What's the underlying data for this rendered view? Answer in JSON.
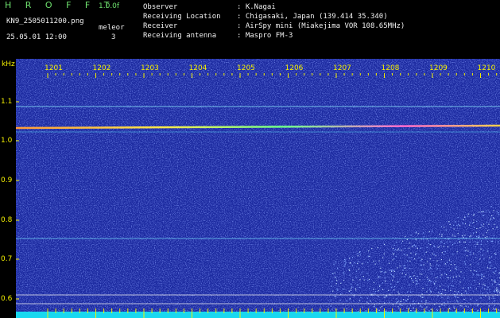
{
  "app": {
    "logo": "H R O F F T",
    "version": "1.0.0f",
    "filename": "KN9_2505011200.png",
    "mode": "meleor",
    "datetime": "25.05.01 12:00",
    "count": "3"
  },
  "info": [
    {
      "label": "Observer",
      "value": ": K.Nagai"
    },
    {
      "label": "Receiving Location",
      "value": ": Chigasaki, Japan (139.414 35.340)"
    },
    {
      "label": "Receiver",
      "value": ": AirSpy mini (Miakejima VOR 108.65MHz)"
    },
    {
      "label": "Receiving antenna",
      "value": ": Maspro FM-3"
    }
  ],
  "axis": {
    "unit": "kHz",
    "y_ticks": [
      "1.1",
      "1.0",
      "0.9",
      "0.8",
      "0.7",
      "0.6"
    ],
    "x_ticks": [
      "1201",
      "1202",
      "1203",
      "1204",
      "1205",
      "1206",
      "1207",
      "1208",
      "1209",
      "1210"
    ]
  },
  "colors": {
    "background": "#1c2aa0",
    "label_yellow": "#f4f000",
    "title_green": "#6ee06e",
    "baseline_cyan": "#18d8f0"
  }
}
